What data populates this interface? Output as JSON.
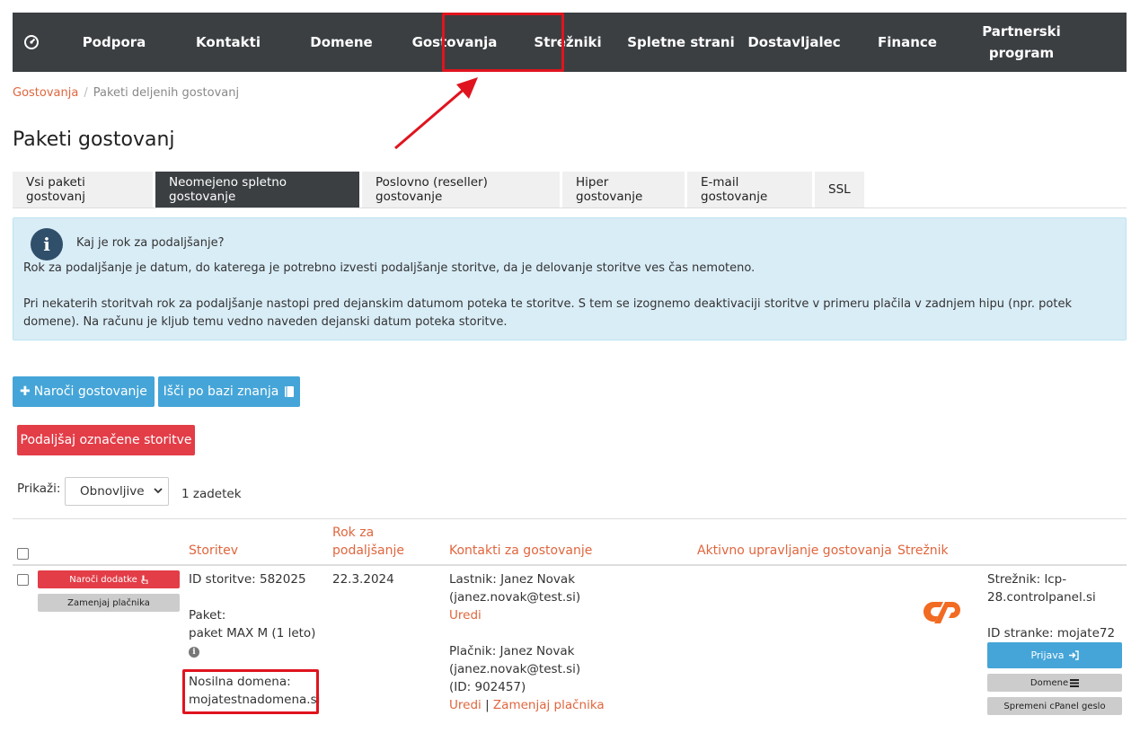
{
  "nav": {
    "items": [
      "Podpora",
      "Kontakti",
      "Domene",
      "Gostovanja",
      "Strežniki",
      "Spletne strani",
      "Dostavljalec",
      "Finance",
      "Partnerski program"
    ]
  },
  "breadcrumb": {
    "parent": "Gostovanja",
    "separator": "/",
    "current": "Paketi deljenih gostovanj"
  },
  "page_title": "Paketi gostovanj",
  "tabs": [
    "Vsi paketi gostovanj",
    "Neomejeno spletno gostovanje",
    "Poslovno (reseller) gostovanje",
    "Hiper gostovanje",
    "E-mail gostovanje",
    "SSL"
  ],
  "info": {
    "icon_glyph": "i",
    "title": "Kaj je rok za podaljšanje?",
    "para1": "Rok za podaljšanje je datum, do katerega je potrebno izvesti podaljšanje storitve, da je delovanje storitve ves čas nemoteno.",
    "para2": "Pri nekaterih storitvah rok za podaljšanje nastopi pred dejanskim datumom poteka te storitve. S tem se izognemo deaktivaciji storitve v primeru plačila v zadnjem hipu (npr. potek domene). Na računu je kljub temu vedno naveden dejanski datum poteka storitve."
  },
  "buttons": {
    "order": "Naroči gostovanje",
    "order_icon": "✚",
    "kb": "Išči po bazi znanja",
    "renew": "Podaljšaj označene storitve"
  },
  "filter": {
    "label": "Prikaži:",
    "selected": "Obnovljive",
    "count": "1 zadetek"
  },
  "table": {
    "headers": {
      "service": "Storitev",
      "renew_line1": "Rok za",
      "renew_line2": "podaljšanje",
      "contacts": "Kontakti za gostovanje",
      "active": "Aktivno upravljanje gostovanja",
      "server": "Strežnik"
    },
    "row": {
      "btn_addons": "Naroči dodatke",
      "btn_change_payer": "Zamenjaj plačnika",
      "id_label": "ID storitve:",
      "id_value": "582025",
      "package_label": "Paket:",
      "package_value": "paket MAX M (1 leto)",
      "domain_label": "Nosilna domena:",
      "domain_value": "mojatestnadomena.si",
      "renew_date": "22.3.2024",
      "owner_label": "Lastnik: Janez Novak",
      "owner_email": "(janez.novak@test.si)",
      "edit": "Uredi",
      "payer_label": "Plačnik: Janez Novak",
      "payer_email": "(janez.novak@test.si)",
      "payer_id": "(ID: 902457)",
      "pipe": "|",
      "change_payer_link": "Zamenjaj plačnika",
      "server_line1": "Strežnik: lcp-",
      "server_line2": "28.controlpanel.si",
      "site_id": "ID stranke: mojate72",
      "login": "Prijava",
      "domains": "Domene",
      "cpanel_pw": "Spremeni cPanel geslo"
    }
  },
  "colors": {
    "nav_bg": "#3b3f42",
    "accent": "#e0663e",
    "blue": "#45a5d8",
    "red": "#e33d47",
    "highlight": "#e0141e",
    "info_bg": "#d9edf7"
  }
}
